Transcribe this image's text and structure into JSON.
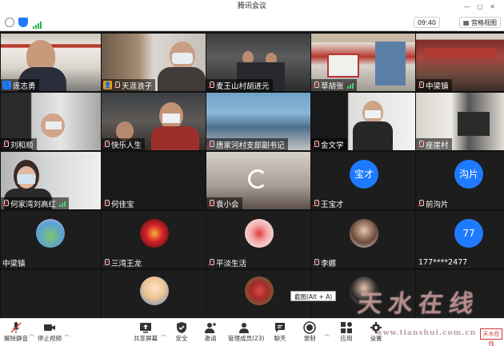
{
  "app": {
    "title": "腾讯会议"
  },
  "header": {
    "time": "09:40",
    "view_label": "宫格视图"
  },
  "participants": [
    {
      "name": "庞志勇"
    },
    {
      "name": "天涯浪子"
    },
    {
      "name": "麦王山村胡进元"
    },
    {
      "name": "草胡张"
    },
    {
      "name": "中梁镇"
    },
    {
      "name": "刘和顺"
    },
    {
      "name": "快乐人生"
    },
    {
      "name": "唐家河村支部副书记"
    },
    {
      "name": "金文学"
    },
    {
      "name": "座崖村"
    },
    {
      "name": "何家湾刘高红"
    },
    {
      "name": "何佳宝"
    },
    {
      "name": "袁小会"
    },
    {
      "name": "王宝才",
      "avatar": "宝才"
    },
    {
      "name": "前沟片",
      "avatar": "沟片"
    },
    {
      "name": "中梁镇"
    },
    {
      "name": "三湾王龙"
    },
    {
      "name": "平淡生活"
    },
    {
      "name": "李娜"
    },
    {
      "name": "177****2477",
      "avatar": "77"
    }
  ],
  "tooltip": "截图(Alt + A)",
  "toolbar": {
    "mute": "解除静音",
    "video": "停止视频",
    "share": "共享屏幕",
    "security": "安全",
    "invite": "邀请",
    "members": "管理成员(23)",
    "chat": "聊天",
    "record": "录制",
    "apps": "应用",
    "settings": "设置"
  },
  "watermark": {
    "text": "天水在线",
    "url": "www.tianshui.com.cn",
    "badge": "天水在线"
  }
}
